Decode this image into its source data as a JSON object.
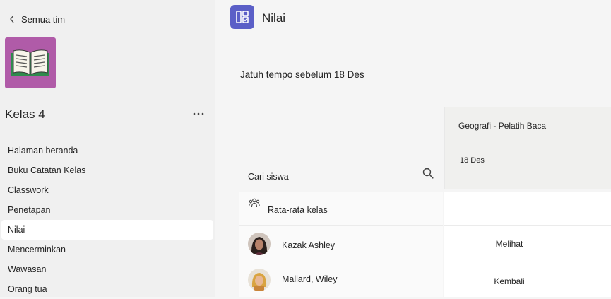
{
  "sidebar": {
    "back_label": "Semua tim",
    "team_name": "Kelas 4",
    "more_label": "···",
    "nav": [
      {
        "label": "Halaman beranda",
        "active": false
      },
      {
        "label": "Buku Catatan Kelas",
        "active": false
      },
      {
        "label": "Classwork",
        "active": false
      },
      {
        "label": "Penetapan",
        "active": false
      },
      {
        "label": "Nilai",
        "active": true
      },
      {
        "label": "Mencerminkan",
        "active": false
      },
      {
        "label": "Wawasan",
        "active": false
      },
      {
        "label": "Orang tua",
        "active": false
      }
    ]
  },
  "header": {
    "title": "Nilai",
    "icon": "grades-app-icon"
  },
  "grades": {
    "due_label": "Jatuh tempo sebelum 18 Des",
    "search_label": "Cari siswa",
    "assignment": {
      "title": "Geografi - Pelatih Baca",
      "date": "18 Des"
    },
    "class_average_label": "Rata-rata kelas",
    "students": [
      {
        "name": "Kazak Ashley",
        "status": "Melihat"
      },
      {
        "name": "Mallard, Wiley",
        "status": "Kembali"
      }
    ]
  },
  "colors": {
    "team_tile": "#b05ba8",
    "app_icon": "#5b5fc7",
    "sidebar_bg": "#f0f0f0",
    "main_bg": "#f5f5f5"
  }
}
